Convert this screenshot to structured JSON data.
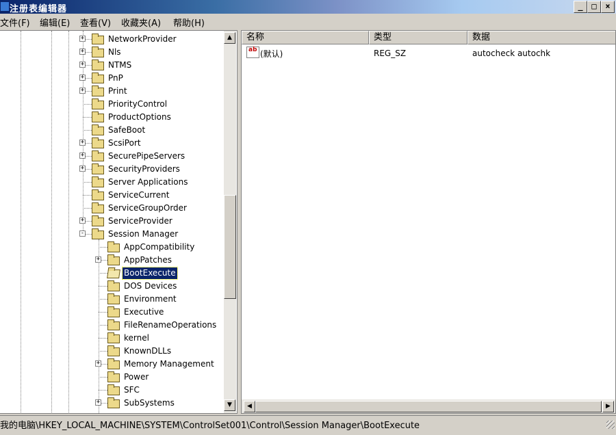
{
  "window": {
    "title": "注册表编辑器",
    "controls": {
      "minimize": "_",
      "maximize": "□",
      "close": "×"
    }
  },
  "menu": [
    "文件(F)",
    "编辑(E)",
    "查看(V)",
    "收藏夹(A)",
    "帮助(H)"
  ],
  "tree": {
    "nodes": [
      {
        "label": "NetworkProvider",
        "level": 0,
        "expander": "+"
      },
      {
        "label": "Nls",
        "level": 0,
        "expander": "+"
      },
      {
        "label": "NTMS",
        "level": 0,
        "expander": "+"
      },
      {
        "label": "PnP",
        "level": 0,
        "expander": "+"
      },
      {
        "label": "Print",
        "level": 0,
        "expander": "+"
      },
      {
        "label": "PriorityControl",
        "level": 0,
        "expander": ""
      },
      {
        "label": "ProductOptions",
        "level": 0,
        "expander": ""
      },
      {
        "label": "SafeBoot",
        "level": 0,
        "expander": ""
      },
      {
        "label": "ScsiPort",
        "level": 0,
        "expander": "+"
      },
      {
        "label": "SecurePipeServers",
        "level": 0,
        "expander": "+"
      },
      {
        "label": "SecurityProviders",
        "level": 0,
        "expander": "+"
      },
      {
        "label": "Server Applications",
        "level": 0,
        "expander": ""
      },
      {
        "label": "ServiceCurrent",
        "level": 0,
        "expander": ""
      },
      {
        "label": "ServiceGroupOrder",
        "level": 0,
        "expander": ""
      },
      {
        "label": "ServiceProvider",
        "level": 0,
        "expander": "+"
      },
      {
        "label": "Session Manager",
        "level": 0,
        "expander": "-"
      },
      {
        "label": "AppCompatibility",
        "level": 1,
        "expander": ""
      },
      {
        "label": "AppPatches",
        "level": 1,
        "expander": "+"
      },
      {
        "label": "BootExecute",
        "level": 1,
        "expander": "",
        "selected": true
      },
      {
        "label": "DOS Devices",
        "level": 1,
        "expander": ""
      },
      {
        "label": "Environment",
        "level": 1,
        "expander": ""
      },
      {
        "label": "Executive",
        "level": 1,
        "expander": ""
      },
      {
        "label": "FileRenameOperations",
        "level": 1,
        "expander": ""
      },
      {
        "label": "kernel",
        "level": 1,
        "expander": ""
      },
      {
        "label": "KnownDLLs",
        "level": 1,
        "expander": ""
      },
      {
        "label": "Memory Management",
        "level": 1,
        "expander": "+"
      },
      {
        "label": "Power",
        "level": 1,
        "expander": ""
      },
      {
        "label": "SFC",
        "level": 1,
        "expander": ""
      },
      {
        "label": "SubSystems",
        "level": 1,
        "expander": "+"
      }
    ]
  },
  "list": {
    "columns": [
      "名称",
      "类型",
      "数据"
    ],
    "rows": [
      {
        "name": "(默认)",
        "type": "REG_SZ",
        "data": "autocheck autochk",
        "icon": "string-value-icon"
      }
    ]
  },
  "scroll_glyphs": {
    "up": "▲",
    "down": "▼",
    "left": "◀",
    "right": "▶"
  },
  "status": "我的电脑\\HKEY_LOCAL_MACHINE\\SYSTEM\\ControlSet001\\Control\\Session Manager\\BootExecute"
}
